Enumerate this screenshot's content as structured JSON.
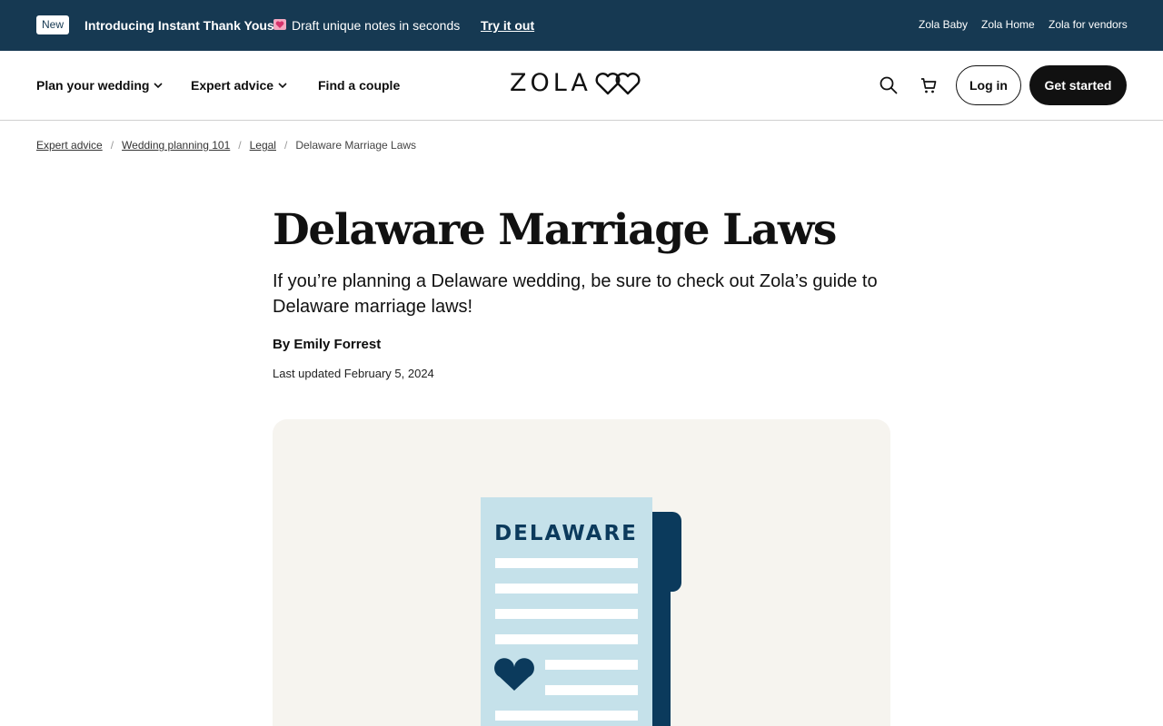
{
  "promo": {
    "badge": "New",
    "title": "Introducing Instant Thank Yous!",
    "text": "Draft unique notes in seconds",
    "link": "Try it out",
    "heart_icon": "heart-emoji-icon",
    "utility_links": [
      "Zola Baby",
      "Zola Home",
      "Zola for vendors"
    ],
    "bg_color": "#163952"
  },
  "nav": {
    "items": [
      {
        "label": "Plan your wedding",
        "dropdown": true
      },
      {
        "label": "Expert advice",
        "dropdown": true
      },
      {
        "label": "Find a couple",
        "dropdown": false
      }
    ],
    "logo": "ZOLA",
    "search_icon": "search-icon",
    "cart_icon": "cart-icon",
    "login": "Log in",
    "get_started": "Get started"
  },
  "breadcrumb": {
    "items": [
      "Expert advice",
      "Wedding planning 101",
      "Legal"
    ],
    "current": "Delaware Marriage Laws"
  },
  "article": {
    "title": "Delaware Marriage Laws",
    "dek": "If you’re planning a Delaware wedding, be sure to check out Zola’s guide to Delaware marriage laws!",
    "byline": "By Emily Forrest",
    "updated": "Last updated February 5, 2024"
  },
  "hero": {
    "document_label": "DELAWARE",
    "colors": {
      "background": "#f6f4ef",
      "paper": "#c5e1ea",
      "navy": "#0b3a5c"
    }
  }
}
